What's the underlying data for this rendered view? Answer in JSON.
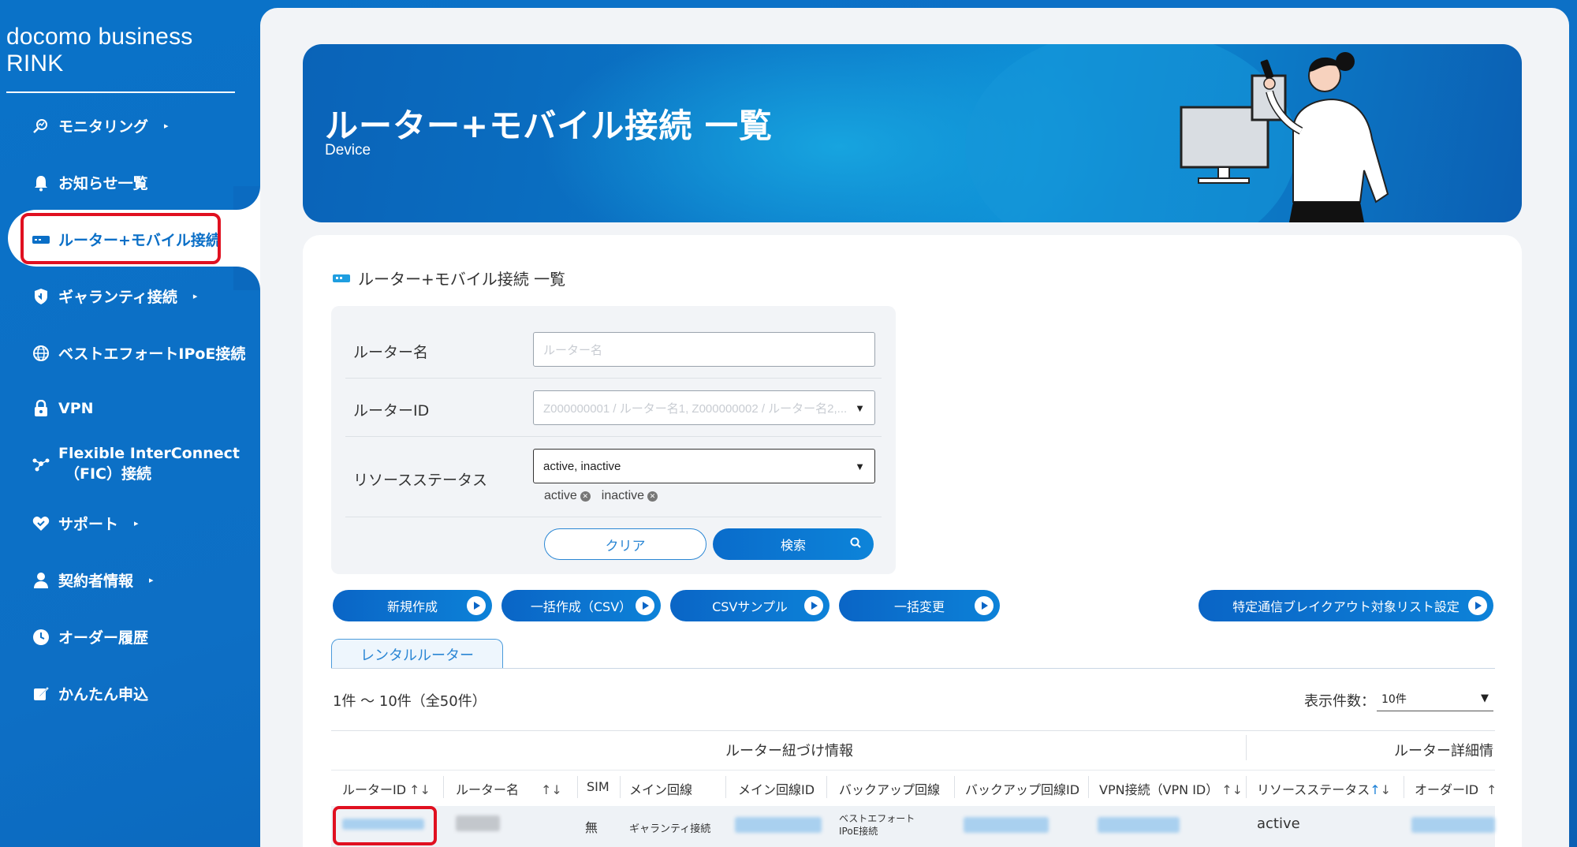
{
  "brand": "docomo business RINK",
  "nav": [
    {
      "label": "モニタリング",
      "icon": "monitoring-icon",
      "arrow": "▸"
    },
    {
      "label": "お知らせ一覧",
      "icon": "bell-icon"
    },
    {
      "label": "ルーター+モバイル接続",
      "icon": "router-icon",
      "active": true
    },
    {
      "label": "ギャランティ接続",
      "icon": "shield-icon",
      "arrow": "▸"
    },
    {
      "label": "ベストエフォートIPoE接続",
      "icon": "globe-icon"
    },
    {
      "label": "VPN",
      "icon": "lock-icon"
    },
    {
      "label_line1": "Flexible InterConnect",
      "label_line2": "（FIC）接続",
      "icon": "network-icon"
    },
    {
      "label": "サポート",
      "icon": "support-icon",
      "arrow": "▸"
    },
    {
      "label": "契約者情報",
      "icon": "person-icon",
      "arrow": "▸"
    },
    {
      "label": "オーダー履歴",
      "icon": "clock-icon"
    },
    {
      "label": "かんたん申込",
      "icon": "edit-icon"
    }
  ],
  "banner": {
    "title": "ルーター+モバイル接続 一覧",
    "subtitle": "Device"
  },
  "section_title": "ルーター+モバイル接続 一覧",
  "search": {
    "router_name_label": "ルーター名",
    "router_name_placeholder": "ルーター名",
    "router_id_label": "ルーターID",
    "router_id_placeholder": "Z000000001 / ルーター名1, Z000000002 / ルーター名2,...",
    "status_label": "リソースステータス",
    "status_value": "active, inactive",
    "chips": [
      "active",
      "inactive"
    ],
    "clear_label": "クリア",
    "search_label": "検索"
  },
  "actions": {
    "new": "新規作成",
    "bulk_create": "一括作成（CSV）",
    "csv_sample": "CSVサンプル",
    "bulk_change": "一括変更",
    "breakout": "特定通信ブレイクアウト対象リスト設定"
  },
  "tab_label": "レンタルルーター",
  "count_text": "1件 ～ 10件（全50件）",
  "per_page_label": "表示件数：",
  "per_page_value": "10件",
  "group_headers": {
    "link_info": "ルーター紐づけ情報",
    "detail_info": "ルーター詳細情"
  },
  "columns": {
    "router_id": "ルーターID",
    "router_name": "ルーター名",
    "sim": "SIM",
    "main_line": "メイン回線",
    "main_line_id": "メイン回線ID",
    "backup_line": "バックアップ回線",
    "backup_line_id": "バックアップ回線ID",
    "vpn": "VPN接続（VPN ID）",
    "status": "リソースステータス",
    "order_id": "オーダーID"
  },
  "row": {
    "sim": "無",
    "main_line": "ギャランティ接続",
    "backup_line_1": "ベストエフォート",
    "backup_line_2": "IPoE接続",
    "status": "active"
  },
  "sort_glyph": "↑↓",
  "sort_up": "↑",
  "sort_down": "↓",
  "colors": {
    "accent": "#0a6fc7",
    "highlight": "#e01020"
  }
}
